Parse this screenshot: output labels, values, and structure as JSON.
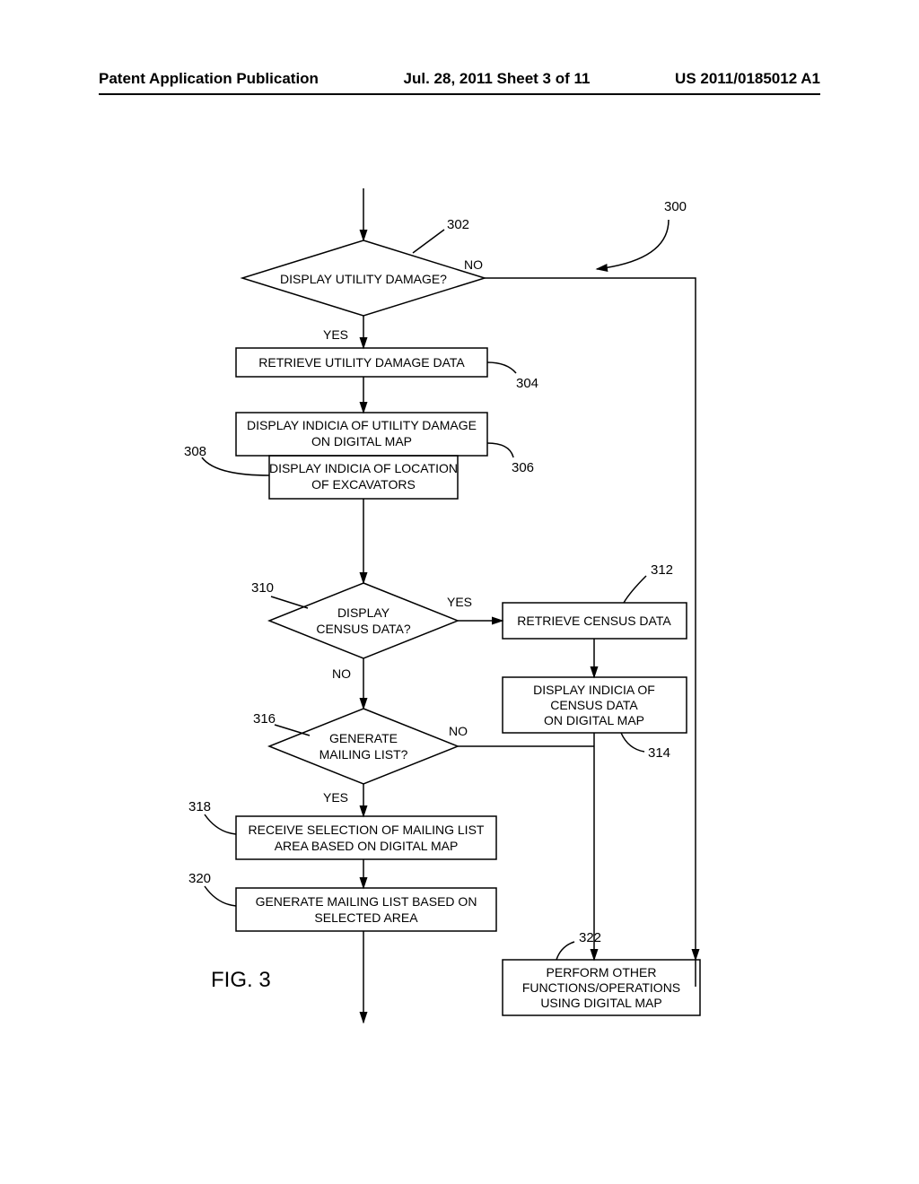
{
  "header": {
    "left": "Patent Application Publication",
    "middle": "Jul. 28, 2011   Sheet 3 of 11",
    "right": "US 2011/0185012 A1"
  },
  "figure_label": "FIG. 3",
  "refs": {
    "r300": "300",
    "r302": "302",
    "r304": "304",
    "r306": "306",
    "r308": "308",
    "r310": "310",
    "r312": "312",
    "r314": "314",
    "r316": "316",
    "r318": "318",
    "r320": "320",
    "r322": "322"
  },
  "labels": {
    "yes": "YES",
    "no": "NO"
  },
  "nodes": {
    "d302": "DISPLAY UTILITY DAMAGE?",
    "b304": "RETRIEVE UTILITY DAMAGE DATA",
    "b306a": "DISPLAY INDICIA OF UTILITY DAMAGE",
    "b306b": "ON DIGITAL MAP",
    "b308a": "DISPLAY INDICIA OF LOCATION",
    "b308b": "OF EXCAVATORS",
    "d310a": "DISPLAY",
    "d310b": "CENSUS DATA?",
    "b312": "RETRIEVE CENSUS DATA",
    "b314a": "DISPLAY INDICIA OF",
    "b314b": "CENSUS DATA",
    "b314c": "ON DIGITAL MAP",
    "d316a": "GENERATE",
    "d316b": "MAILING LIST?",
    "b318a": "RECEIVE SELECTION OF MAILING LIST",
    "b318b": "AREA BASED ON DIGITAL MAP",
    "b320a": "GENERATE MAILING LIST BASED ON",
    "b320b": "SELECTED AREA",
    "b322a": "PERFORM OTHER",
    "b322b": "FUNCTIONS/OPERATIONS",
    "b322c": "USING DIGITAL MAP"
  }
}
